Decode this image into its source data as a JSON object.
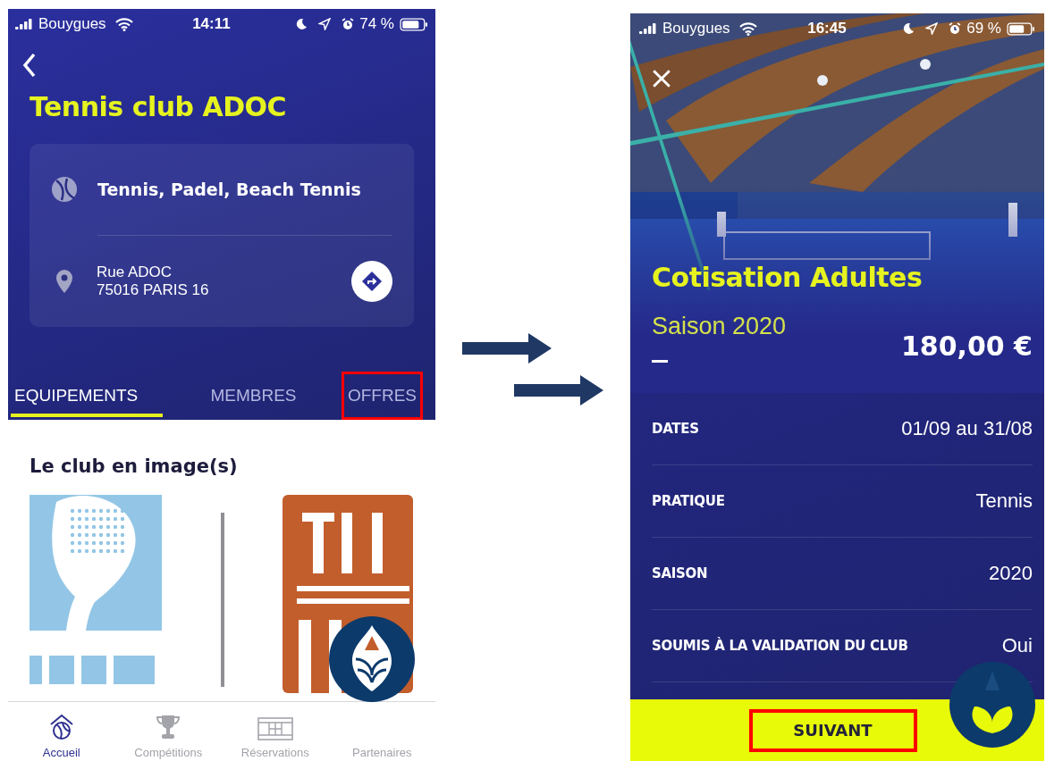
{
  "club_screen": {
    "status_bar": {
      "carrier": "Bouygues",
      "time": "14:11",
      "battery": "74 %"
    },
    "title": "Tennis club ADOC",
    "info_card": {
      "sports": "Tennis, Padel, Beach Tennis",
      "address_lines": [
        "Rue ADOC",
        "75016 PARIS 16"
      ]
    },
    "tabs": [
      {
        "label": "EQUIPEMENTS",
        "selected": true,
        "highlighted": false
      },
      {
        "label": "MEMBRES",
        "selected": false,
        "highlighted": false
      },
      {
        "label": "OFFRES",
        "selected": false,
        "highlighted": true
      }
    ],
    "section_title": "Le club en image(s)",
    "bottom_nav": [
      {
        "label": "Accueil",
        "selected": true
      },
      {
        "label": "Compétitions",
        "selected": false
      },
      {
        "label": "Réservations",
        "selected": false
      },
      {
        "label": "Partenaires",
        "selected": false
      }
    ]
  },
  "offer_screen": {
    "status_bar": {
      "carrier": "Bouygues",
      "time": "16:45",
      "battery": "69 %"
    },
    "title": "Cotisation Adultes",
    "subtitle": "Saison 2020",
    "price": "180,00 €",
    "details": [
      {
        "label": "DATES",
        "value": "01/09 au 31/08"
      },
      {
        "label": "PRATIQUE",
        "value": "Tennis"
      },
      {
        "label": "SAISON",
        "value": "2020"
      },
      {
        "label": "SOUMIS À LA VALIDATION DU CLUB",
        "value": "Oui"
      }
    ],
    "button": {
      "label": "SUIVANT",
      "highlighted": true
    }
  }
}
